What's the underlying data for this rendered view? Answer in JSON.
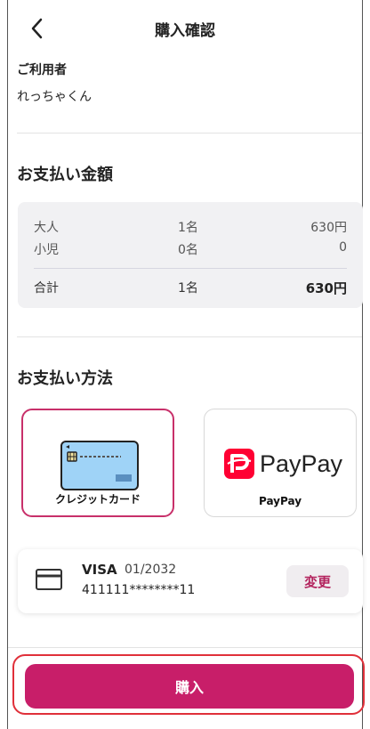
{
  "header": {
    "title": "購入確認"
  },
  "user": {
    "label": "ご利用者",
    "name": "れっちゃくん"
  },
  "amount": {
    "title": "お支払い金額",
    "rows": [
      {
        "label": "大人",
        "count": "1名",
        "price": "630円"
      },
      {
        "label": "小児",
        "count": "0名",
        "price": "0"
      }
    ],
    "total": {
      "label": "合計",
      "count": "1名",
      "price": "630円"
    }
  },
  "payment": {
    "title": "お支払い方法",
    "options": [
      {
        "label": "クレジットカード",
        "selected": true
      },
      {
        "label": "PayPay",
        "selected": false
      }
    ],
    "paypay_logo_text": "PayPay"
  },
  "saved_card": {
    "brand": "VISA",
    "expiry": "01/2032",
    "number": "411111********11",
    "change_label": "変更"
  },
  "buy_button": {
    "label": "購入"
  },
  "colors": {
    "accent": "#c81e69",
    "selected_border": "#c8306a",
    "paypay_red": "#ff0033",
    "card_blue": "#9fd3f7"
  }
}
